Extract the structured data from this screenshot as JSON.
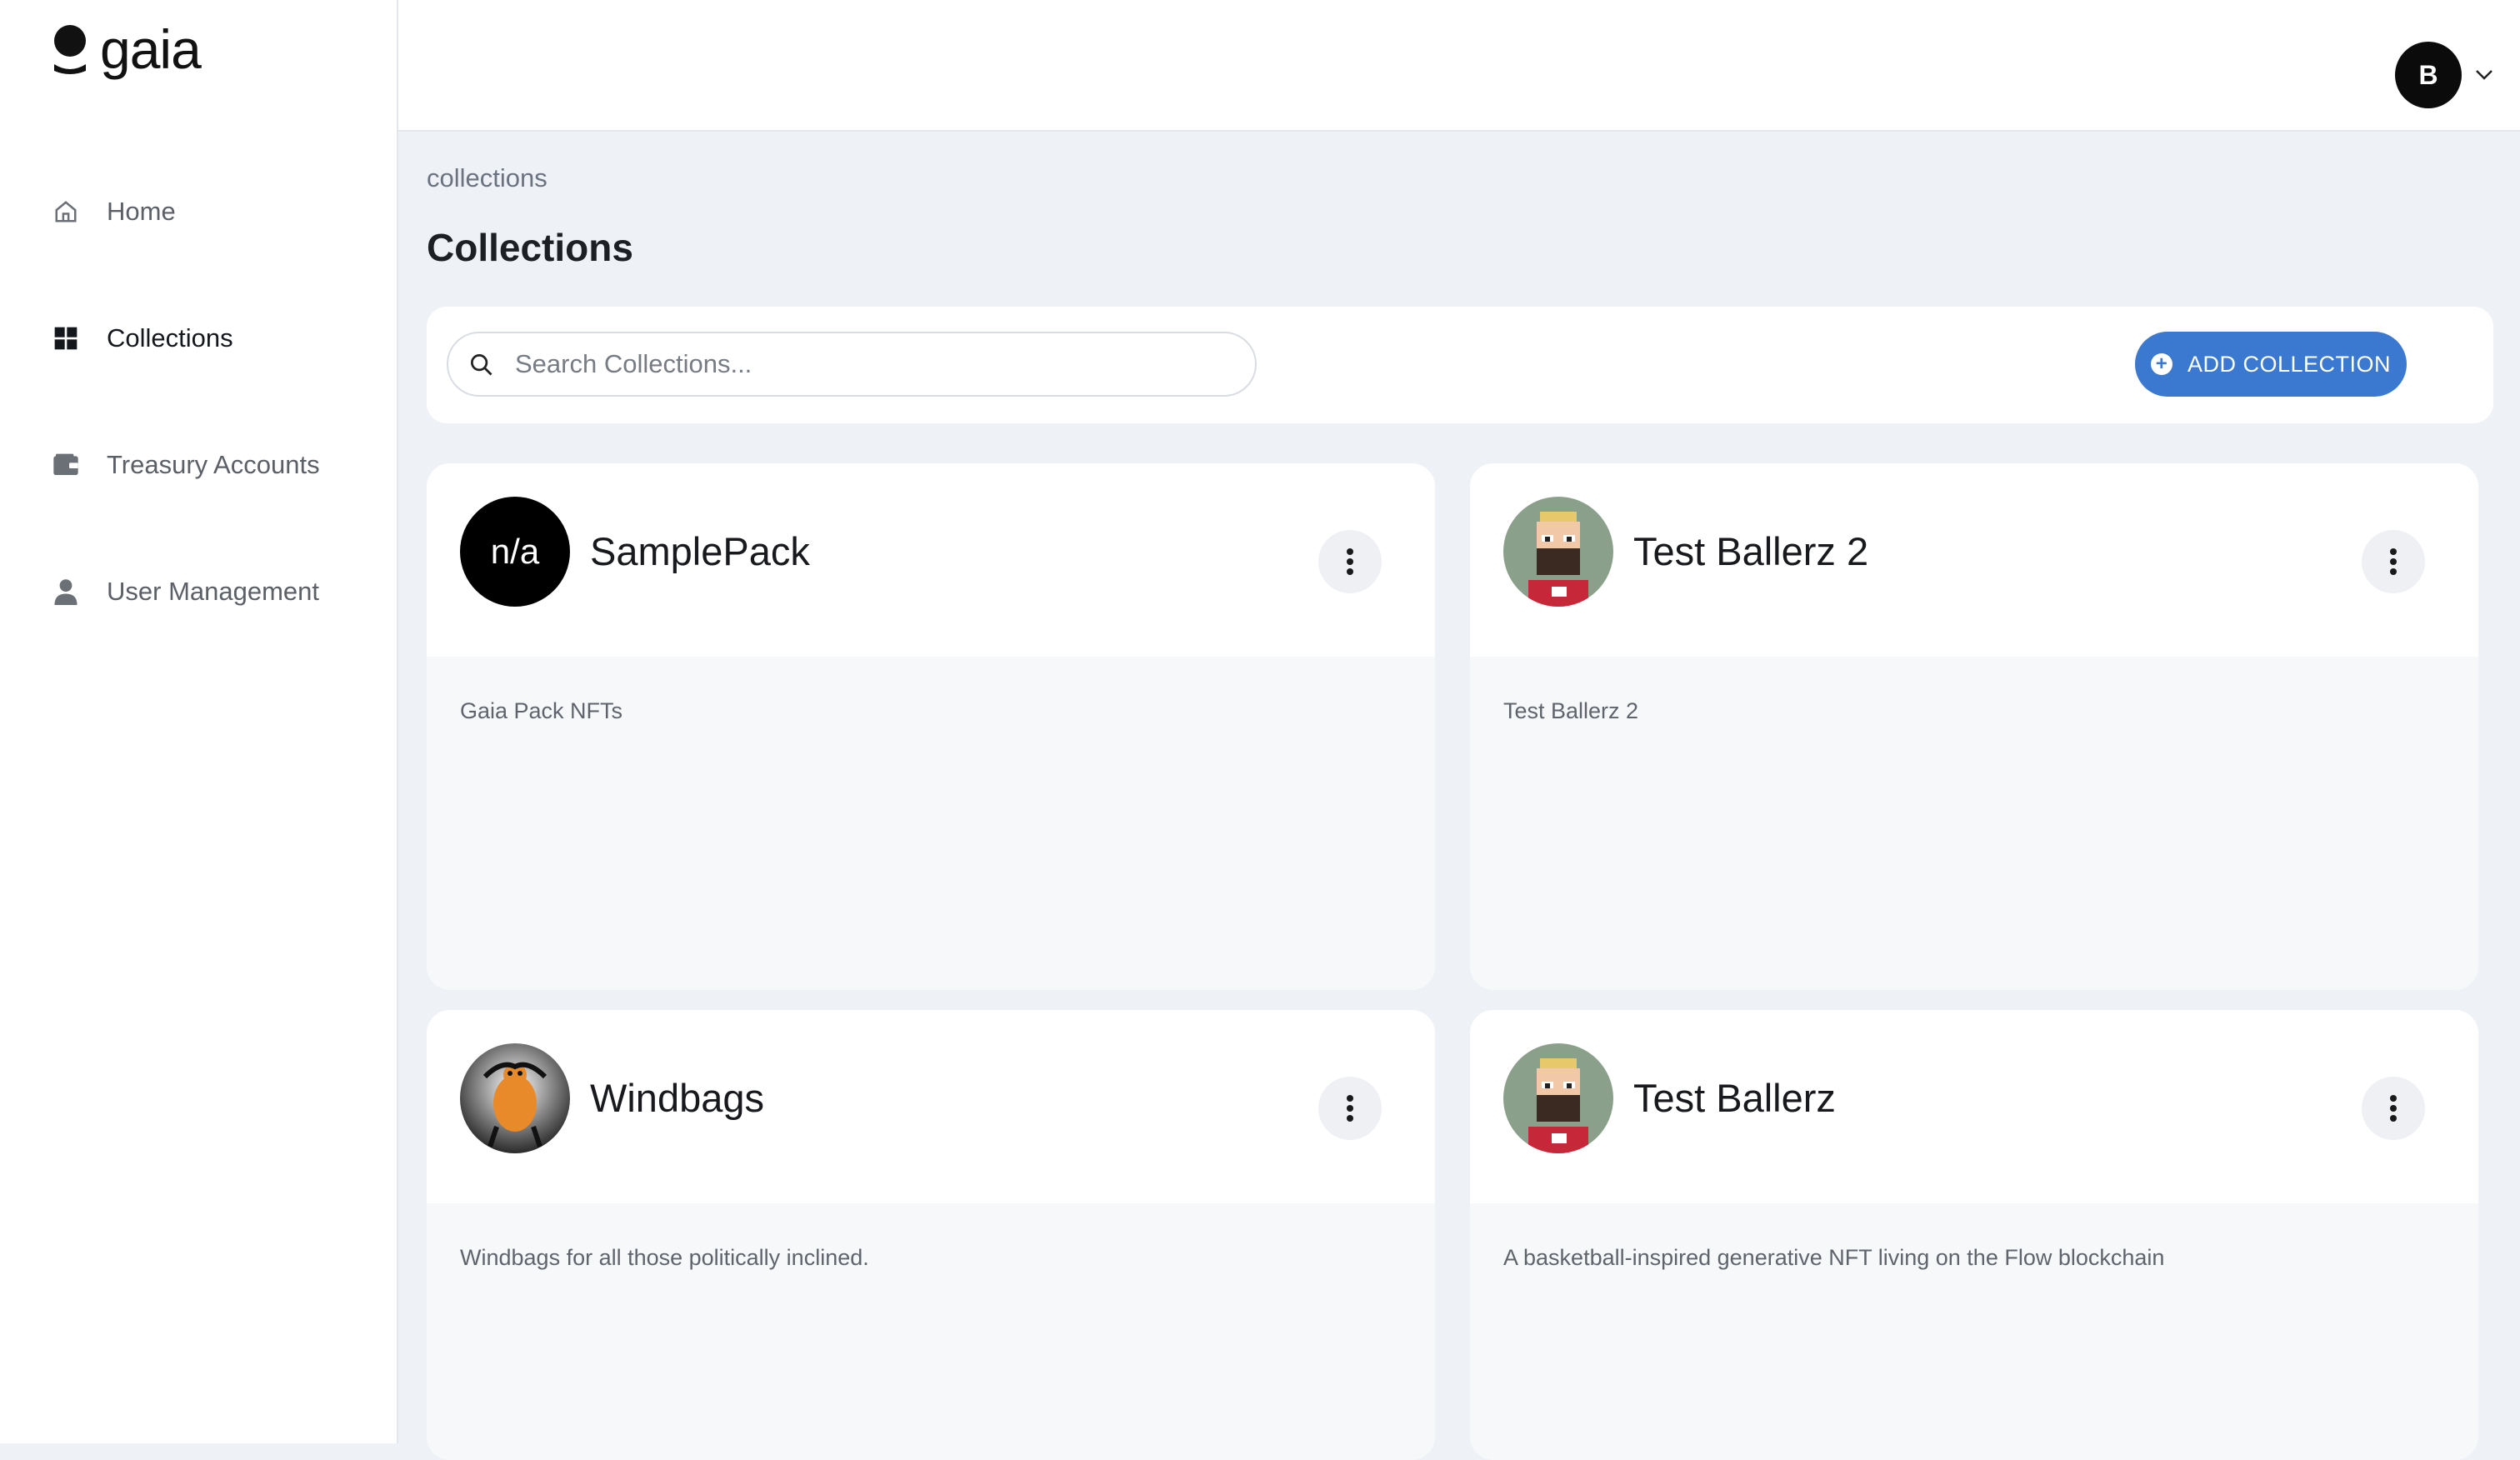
{
  "brand": {
    "name": "gaia"
  },
  "sidebar": {
    "items": [
      {
        "label": "Home",
        "icon": "home-icon"
      },
      {
        "label": "Collections",
        "icon": "grid-icon",
        "active": true
      },
      {
        "label": "Treasury Accounts",
        "icon": "wallet-icon"
      },
      {
        "label": "User Management",
        "icon": "user-icon"
      }
    ]
  },
  "header": {
    "avatar_initial": "B"
  },
  "breadcrumb": "collections",
  "page_title": "Collections",
  "toolbar": {
    "search_placeholder": "Search Collections...",
    "add_label": "ADD COLLECTION",
    "accent_color": "#3b78cf"
  },
  "collections": [
    {
      "name": "SamplePack",
      "description": "Gaia Pack NFTs",
      "avatar_text": "n/a"
    },
    {
      "name": "Test Ballerz 2",
      "description": "Test Ballerz 2"
    },
    {
      "name": "Windbags",
      "description": "Windbags for all those politically inclined."
    },
    {
      "name": "Test Ballerz",
      "description": "A basketball-inspired generative NFT living on the Flow blockchain"
    }
  ]
}
